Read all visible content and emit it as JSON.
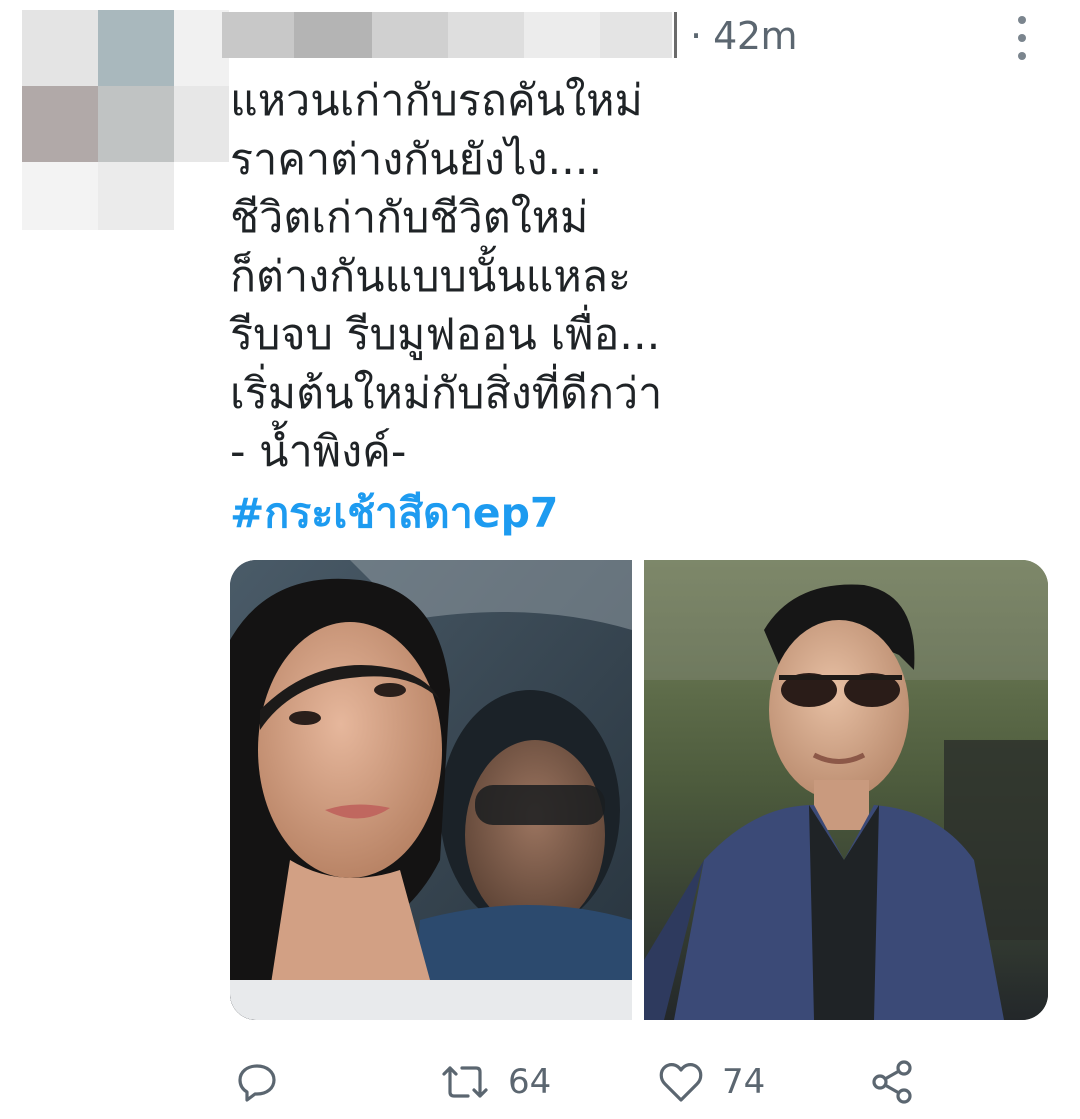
{
  "tweet": {
    "timestamp": "· 42m",
    "lines": [
      "แหวนเก่ากับรถคันใหม่",
      "ราคาต่างกันยังไง....",
      "ชีวิตเก่ากับชีวิตใหม่",
      "ก็ต่างกันแบบนั้นแหละ",
      "รีบจบ รีบมูฟออน เพื่อ...",
      "เริ่มต้นใหม่กับสิ่งที่ดีกว่า",
      "- น้ำพิงค์-"
    ],
    "hashtag": "#กระเช้าสีดาep7"
  },
  "actions": {
    "reply_icon": "reply-icon",
    "retweet_icon": "retweet-icon",
    "retweet_count": "64",
    "like_icon": "heart-icon",
    "like_count": "74",
    "share_icon": "share-icon"
  },
  "colors": {
    "hashtag": "#1d9bf0",
    "secondary_text": "#5b6670"
  }
}
